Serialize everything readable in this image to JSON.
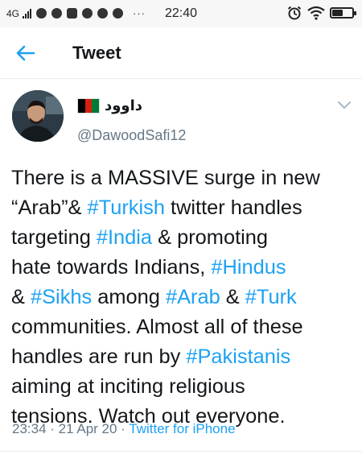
{
  "status_bar": {
    "network": "4G",
    "time": "22:40",
    "overflow": "···",
    "battery_level": 0.55,
    "icons": [
      "signal-icon",
      "app-icon",
      "app-icon",
      "app-icon",
      "app-icon",
      "app-icon",
      "app-icon",
      "alarm-icon",
      "wifi-icon",
      "battery-icon"
    ]
  },
  "header": {
    "back_icon": "arrow-left-icon",
    "title": "Tweet"
  },
  "tweet": {
    "display_name": "داوود",
    "handle": "@DawoodSafi12",
    "flag": "afghanistan-flag-icon",
    "flag_colors": [
      "#000000",
      "#d32011",
      "#007a36"
    ],
    "lines": [
      [
        {
          "t": "There is a MASSIVE surge in new"
        }
      ],
      [
        {
          "t": "“Arab”& "
        },
        {
          "t": "#Turkish",
          "tag": true
        },
        {
          "t": " twitter handles"
        }
      ],
      [
        {
          "t": "targeting "
        },
        {
          "t": "#India",
          "tag": true
        },
        {
          "t": " & promoting"
        }
      ],
      [
        {
          "t": "hate towards Indians, "
        },
        {
          "t": "#Hindus",
          "tag": true
        }
      ],
      [
        {
          "t": "& "
        },
        {
          "t": "#Sikhs",
          "tag": true
        },
        {
          "t": " among "
        },
        {
          "t": "#Arab",
          "tag": true
        },
        {
          "t": " & "
        },
        {
          "t": "#Turk",
          "tag": true
        }
      ],
      [
        {
          "t": "communities. Almost all of these"
        }
      ],
      [
        {
          "t": "handles are run by "
        },
        {
          "t": "#Pakistanis",
          "tag": true
        }
      ],
      [
        {
          "t": "aiming at inciting religious"
        }
      ],
      [
        {
          "t": "tensions. Watch out everyone."
        }
      ]
    ],
    "time": "23:34",
    "sep1": " · ",
    "date": "21 Apr 20",
    "sep2": " · ",
    "source": "Twitter for iPhone"
  },
  "colors": {
    "link": "#1da1f2",
    "secondary_text": "#657786",
    "primary_text": "#14171a"
  }
}
